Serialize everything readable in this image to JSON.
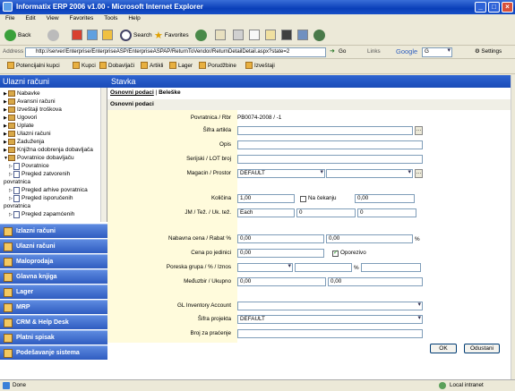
{
  "window": {
    "title": "Informatix ERP 2006 v1.00 - Microsoft Internet Explorer"
  },
  "menu": [
    "File",
    "Edit",
    "View",
    "Favorites",
    "Tools",
    "Help"
  ],
  "toolbar": {
    "back": "Back",
    "search": "Search",
    "favorites": "Favorites"
  },
  "address": {
    "label": "Address",
    "url": "http://server/Enterprise/EnterpriseASP/EnterpriseASPAP/ReturnToVendor/ReturnDetailDetail.aspx?state=2",
    "go": "Go",
    "links": "Links",
    "google": "Google",
    "google_sel": "G",
    "settings": "Settings"
  },
  "linksbar": [
    "Potencijalni kupci",
    "Kupci",
    "Dobavljači",
    "Artikli",
    "Lager",
    "Porudžbine",
    "Izveštaji"
  ],
  "left": {
    "title": "Ulazni računi",
    "tree": [
      "Nabavke",
      "Avansni računi",
      "Izveštaji troškova",
      "Ugovori",
      "Uplate",
      "Ulazni računi",
      "Zaduženja",
      "Knjižna odobrenja dobavljača",
      "Povratnice dobavljaču",
      "Povratnice",
      "Pregled zatvorenih",
      "povratnica",
      "Pregled arhive povratnica",
      "Pregled isporučenih",
      "povratnica",
      "Pregled zapamćenih"
    ],
    "buttons": [
      "Izlazni računi",
      "Ulazni računi",
      "Maloprodaja",
      "Glavna knjiga",
      "Lager",
      "MRP",
      "CRM & Help Desk",
      "Platni spisak",
      "Podešavanje sistema"
    ]
  },
  "right": {
    "title": "Stavka",
    "tab_active": "Osnovni podaci",
    "tab_other": "Beleške",
    "section": "Osnovni podaci",
    "labels": {
      "povratnica": "Povratnica / Rbr",
      "sifra": "Šifra artikla",
      "opis": "Opis",
      "serijski": "Serijski / LOT broj",
      "magacin": "Magacin / Prostor",
      "kolicina": "Količina",
      "jm": "JM / Tež. / Uk. tež.",
      "nabavna": "Nabavna cena / Rabat %",
      "cena": "Cena po jedinici",
      "poreska": "Poreska grupa / % / Iznos",
      "medjuzbir": "Međuzbir / Ukupno",
      "gl": "GL Inventory Account",
      "sifra_proj": "Šifra projekta",
      "broj_prac": "Broj za praćenje"
    },
    "values": {
      "povratnica": "PB0074-2008 / -1",
      "magacin": "DEFAULT",
      "kolicina": "1,00",
      "na_cekanju": "Na čekanju",
      "na_cekanju_val": "0,00",
      "jm": "Each",
      "tez": "0",
      "uk_tez": "0",
      "nabavna": "0,00",
      "rabat": "0,00",
      "rabat_unit": "%",
      "cena": "0,00",
      "oporezivo": "Oporezivo",
      "poreska_pct": "%",
      "medjuzbir": "0,00",
      "ukupno": "0,00",
      "sifra_proj": "DEFAULT"
    },
    "ok": "OK",
    "cancel": "Odustani"
  },
  "status": {
    "left": "Done",
    "right": "Local intranet"
  }
}
